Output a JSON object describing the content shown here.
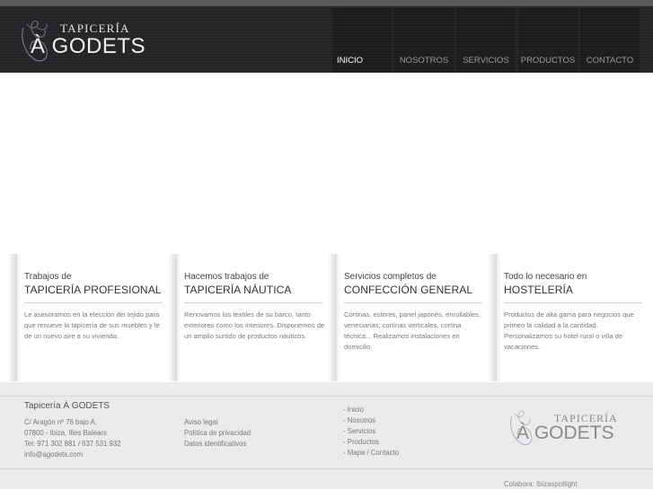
{
  "brand": {
    "line1": "TAPICERÍA",
    "line2": "À GODETS"
  },
  "nav": [
    {
      "label": "INICIO",
      "active": true
    },
    {
      "label": "NOSOTROS",
      "active": false
    },
    {
      "label": "SERVICIOS",
      "active": false
    },
    {
      "label": "PRODUCTOS",
      "active": false
    },
    {
      "label": "CONTACTO",
      "active": false
    }
  ],
  "columns": [
    {
      "kicker": "Trabajos de",
      "title": "TAPICERÍA PROFESIONAL",
      "desc": "Le asesoramos en la elección del tejido para que renueve la tapicería de sus muebles y le de un nuevo aire a su vivienda."
    },
    {
      "kicker": "Hacemos trabajos de",
      "title": "TAPICERÍA NÁUTICA",
      "desc": "Renovamos los textiles de su barco, tanto exteriores como los interiores. Disponemos de un amplio surtido de productos náuticos."
    },
    {
      "kicker": "Servicios completos de",
      "title": "CONFECCIÓN GENERAL",
      "desc": "Cortinas, estores, panel japonés, enrollables, venecianas, cortinas verticales, cortina técnica... Realizamos instalaciones en domicilio."
    },
    {
      "kicker": "Todo lo necesario en",
      "title": "HOSTELERÍA",
      "desc": "Productos de alta gama para negocios que primen la calidad a la cantidad. Personalizamos su hotel rural o villa de vacaciones."
    }
  ],
  "footer": {
    "company": "Tapicería À GODETS",
    "address": [
      "C/ Aragón nº 76 bajo A,",
      "07800 - Ibiza, Illes Balears",
      "Tel: 971 302 881 / 637 531 932",
      "info@agodets.com"
    ],
    "legal": [
      "Aviso legal",
      "Política de privacidad",
      "Datos identificativos"
    ],
    "links": [
      "- Inicio",
      "- Nosotros",
      "- Servicios",
      "- Productos",
      "- Mapa / Contacto"
    ],
    "logo_line1": "TAPICERÍA",
    "logo_line2": "À GODETS",
    "collab": "Colabora: Ibizaspotlight"
  },
  "colors": {
    "header_bg": "#262426",
    "nav_tile_bg": "#1d1b1d",
    "footer_bg": "#ebebeb",
    "text_dark": "#333333",
    "text_muted": "#7a7a7a"
  }
}
